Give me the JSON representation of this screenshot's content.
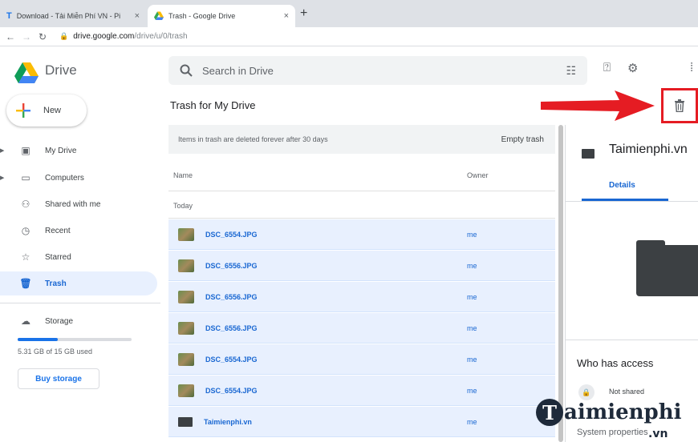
{
  "browser": {
    "tabs": [
      {
        "title": "Download - Tải Miễn Phí VN - Pi",
        "favicon": "T",
        "active": false
      },
      {
        "title": "Trash - Google Drive",
        "active": true
      }
    ],
    "close_glyph": "×",
    "newtab_glyph": "+",
    "url_host": "drive.google.com",
    "url_path": "/drive/u/0/trash"
  },
  "header": {
    "brand": "Drive",
    "search_placeholder": "Search in Drive"
  },
  "sidebar": {
    "new_label": "New",
    "items": [
      {
        "label": "My Drive",
        "icon": "drive-icon",
        "glyph": "▣"
      },
      {
        "label": "Computers",
        "icon": "computer-icon",
        "glyph": "▭"
      },
      {
        "label": "Shared with me",
        "icon": "people-icon",
        "glyph": "⚇"
      },
      {
        "label": "Recent",
        "icon": "clock-icon",
        "glyph": "◷"
      },
      {
        "label": "Starred",
        "icon": "star-icon",
        "glyph": "☆"
      },
      {
        "label": "Trash",
        "icon": "trash-icon",
        "glyph": "🗑"
      }
    ],
    "storage_label": "Storage",
    "storage_used_text": "5.31 GB of 15 GB used",
    "storage_fraction": 0.354,
    "buy_label": "Buy storage"
  },
  "main": {
    "title": "Trash for My Drive",
    "banner_message": "Items in trash are deleted forever after 30 days",
    "empty_trash_label": "Empty trash",
    "columns": {
      "name": "Name",
      "owner": "Owner"
    },
    "section_label": "Today",
    "rows": [
      {
        "name": "DSC_6554.JPG",
        "owner": "me",
        "type": "image"
      },
      {
        "name": "DSC_6556.JPG",
        "owner": "me",
        "type": "image"
      },
      {
        "name": "DSC_6556.JPG",
        "owner": "me",
        "type": "image"
      },
      {
        "name": "DSC_6556.JPG",
        "owner": "me",
        "type": "image"
      },
      {
        "name": "DSC_6554.JPG",
        "owner": "me",
        "type": "image"
      },
      {
        "name": "DSC_6554.JPG",
        "owner": "me",
        "type": "image"
      },
      {
        "name": "Taimienphi.vn",
        "owner": "me",
        "type": "folder"
      }
    ]
  },
  "details": {
    "name": "Taimienphi.vn",
    "tab_label": "Details",
    "access_title": "Who has access",
    "sharing_status": "Not shared",
    "system_properties": "System properties"
  },
  "watermark": {
    "text": "aimienphi",
    "suffix": ".vn"
  },
  "colors": {
    "highlight": "#e51c23",
    "accent": "#1a73e8",
    "selected_row": "#e8f0fe"
  }
}
